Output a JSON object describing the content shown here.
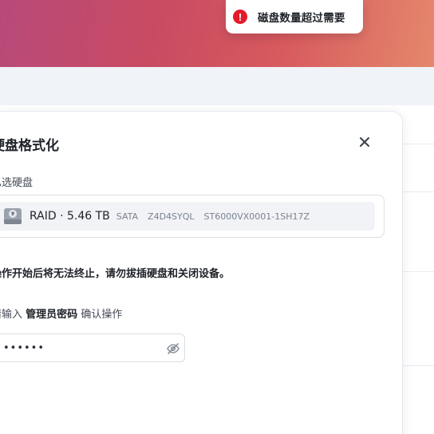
{
  "toast": {
    "message": "磁盘数量超过需要",
    "icon": "error-icon"
  },
  "dialog": {
    "title": "硬盘格式化",
    "selected_label": "已选硬盘",
    "disk": {
      "name": "RAID · 5.46 TB",
      "interface": "SATA",
      "serial": "Z4D4SYQL",
      "model": "ST6000VX0001-1SH17Z"
    },
    "warning": "操作开始后将无法终止，请勿拔插硬盘和关闭设备。",
    "confirm": {
      "prefix": "请输入",
      "emphasis": "管理员密码",
      "suffix": "确认操作"
    },
    "password_value": "••••••"
  },
  "colors": {
    "error": "#e31b2b",
    "hero_start": "#b84a7a",
    "hero_end": "#e4886c"
  }
}
